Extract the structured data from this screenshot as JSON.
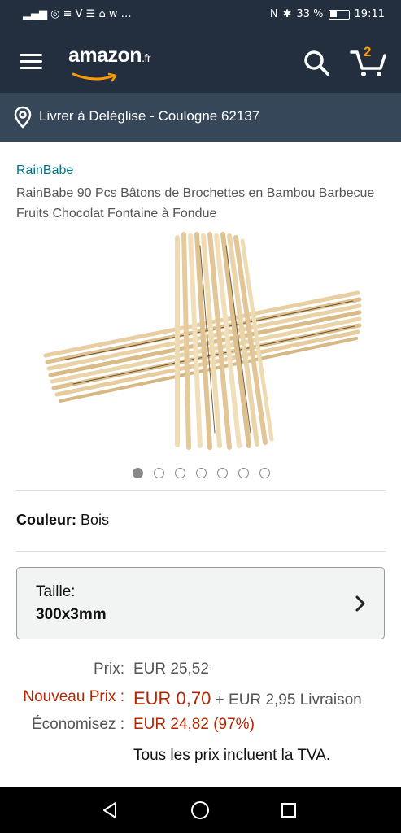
{
  "status": {
    "left_glyphs": "▂▄▆ ◎ ≡ V ☰ ⌂ w …",
    "battery_pct": "33 %",
    "time": "19:11"
  },
  "header": {
    "logo_main": "amazon",
    "logo_tld": ".fr",
    "cart_count": "2",
    "menu_icon": "hamburger-icon",
    "search_icon": "search-icon",
    "cart_icon": "cart-icon",
    "colors": {
      "bg": "#232f3e",
      "accent": "#ff9900"
    }
  },
  "delivery": {
    "text": "Livrer à Deléglise - Coulogne 62137",
    "icon": "location-pin-icon"
  },
  "product": {
    "brand": "RainBabe",
    "title": "RainBabe 90 Pcs Bâtons de Brochettes en Bambou Barbecue Fruits Chocolat Fontaine à Fondue",
    "image_count": 7,
    "active_image": 1
  },
  "color": {
    "label": "Couleur:",
    "value": "Bois"
  },
  "size": {
    "label": "Taille:",
    "value": "300x3mm"
  },
  "price": {
    "price_label": "Prix:",
    "old_price": "EUR 25,52",
    "new_label": "Nouveau Prix :",
    "new_price": "EUR 0,70",
    "shipping": "+ EUR 2,95 Livraison",
    "savings_label": "Économisez :",
    "savings": "EUR 24,82 (97%)",
    "tva_note": "Tous les prix incluent la TVA."
  }
}
